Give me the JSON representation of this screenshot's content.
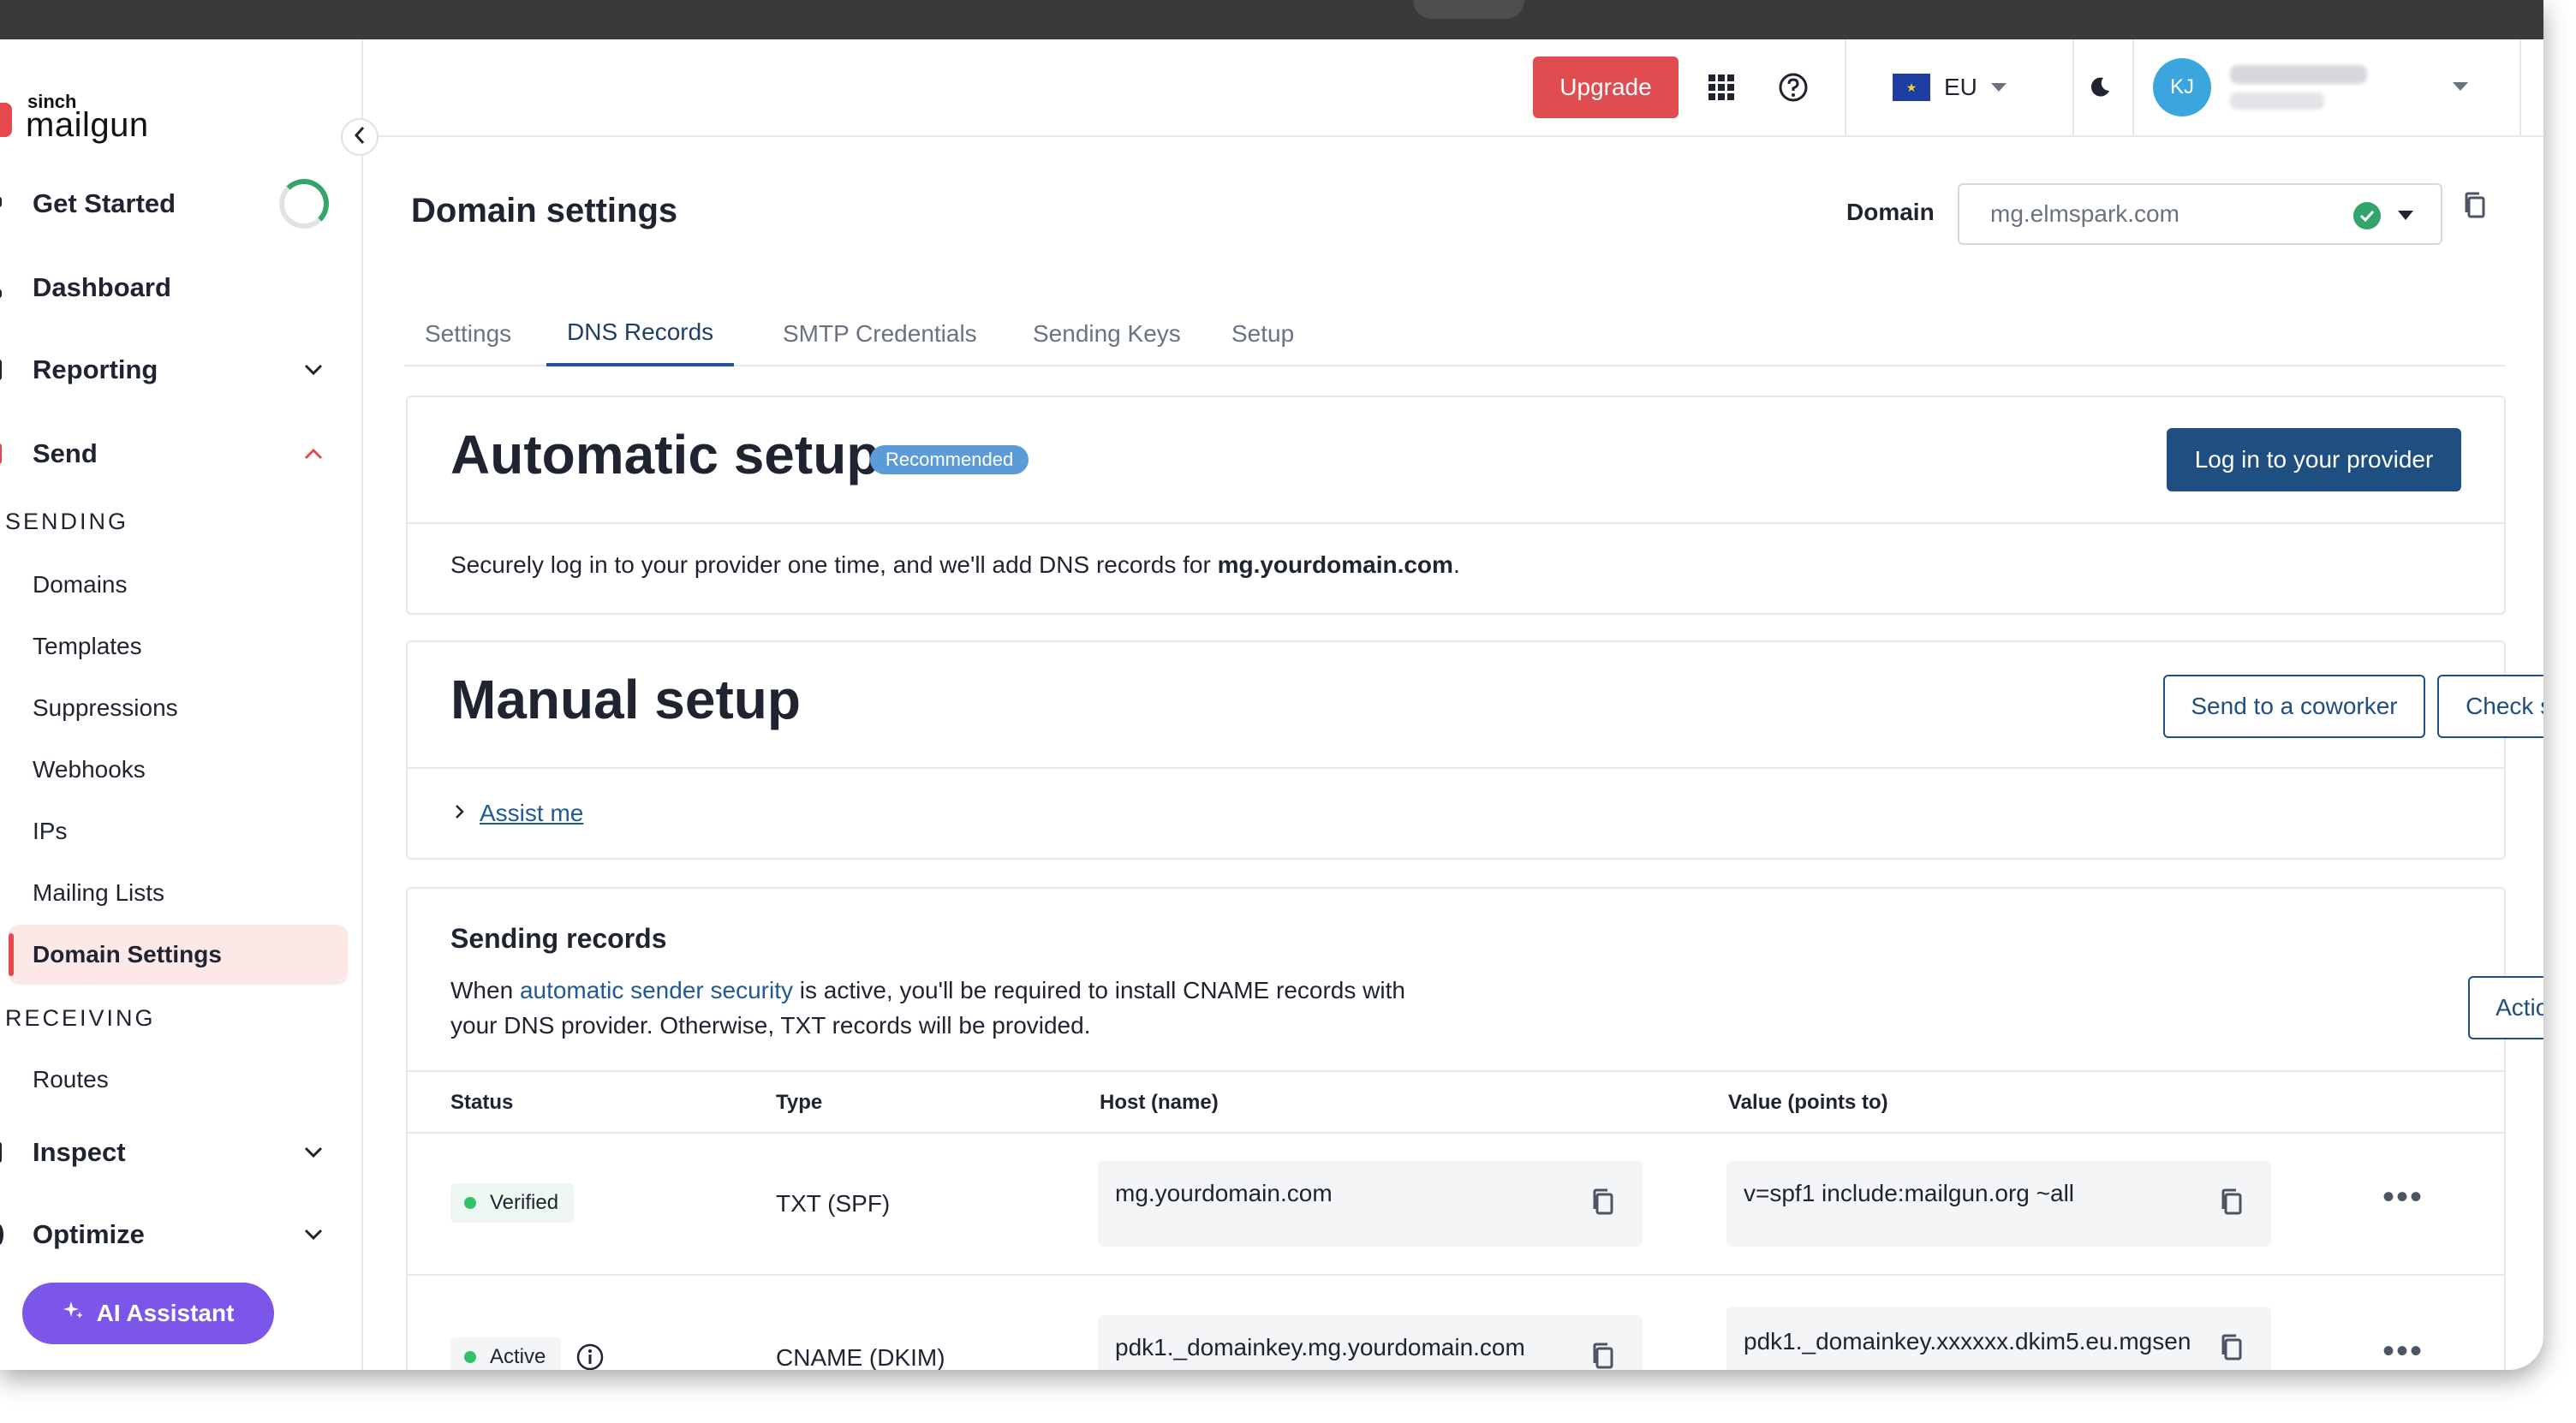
{
  "sidebar": {
    "brand_small": "sinch",
    "brand": "mailgun",
    "nav_main": [
      {
        "label": "Get Started"
      },
      {
        "label": "Dashboard"
      },
      {
        "label": "Reporting"
      },
      {
        "label": "Send"
      }
    ],
    "sending_section": "SENDING",
    "sending_items": [
      {
        "label": "Domains"
      },
      {
        "label": "Templates"
      },
      {
        "label": "Suppressions"
      },
      {
        "label": "Webhooks"
      },
      {
        "label": "IPs"
      },
      {
        "label": "Mailing Lists"
      },
      {
        "label": "Domain Settings"
      }
    ],
    "receiving_section": "RECEIVING",
    "receiving_items": [
      {
        "label": "Routes"
      }
    ],
    "nav_bottom": [
      {
        "label": "Inspect"
      },
      {
        "label": "Optimize"
      }
    ],
    "ai_assistant": "AI Assistant",
    "active_item": "Domain Settings"
  },
  "header": {
    "upgrade": "Upgrade",
    "region": "EU",
    "avatar_initials": "KJ"
  },
  "page": {
    "title": "Domain settings",
    "domain_label": "Domain",
    "domain_value": "mg.elmspark.com"
  },
  "tabs": [
    {
      "label": "Settings"
    },
    {
      "label": "DNS Records"
    },
    {
      "label": "SMTP Credentials"
    },
    {
      "label": "Sending Keys"
    },
    {
      "label": "Setup"
    }
  ],
  "active_tab": "DNS Records",
  "automatic": {
    "title": "Automatic setup",
    "badge": "Recommended",
    "login_button": "Log in to your provider",
    "desc_prefix": "Securely log in to your provider one time, and we'll add DNS records for ",
    "desc_domain": "mg.yourdomain.com",
    "desc_suffix": "."
  },
  "manual": {
    "title": "Manual setup",
    "send_button": "Send to a coworker",
    "check_button": "Check status",
    "assist": "Assist me"
  },
  "sending_records": {
    "title": "Sending records",
    "desc_1": "When ",
    "desc_link": "automatic sender security",
    "desc_2": " is active, you'll be required to install CNAME records with",
    "desc_3": "your DNS provider. Otherwise, TXT records will be provided.",
    "actions": "Actions",
    "columns": [
      "Status",
      "Type",
      "Host (name)",
      "Value (points to)"
    ],
    "rows": [
      {
        "status": "Verified",
        "type": "TXT (SPF)",
        "host": "mg.yourdomain.com",
        "value": "v=spf1 include:mailgun.org ~all"
      },
      {
        "status": "Active",
        "type": "CNAME (DKIM)",
        "host": "pdk1._domainkey.mg.yourdomain.com",
        "value": "pdk1._domainkey.xxxxxx.dkim5.eu.mgsen"
      }
    ]
  },
  "colors": {
    "brand_red": "#df4d50",
    "primary_blue": "#1f4e80",
    "ai_purple": "#7b56e8",
    "status_green": "#33c26a"
  }
}
